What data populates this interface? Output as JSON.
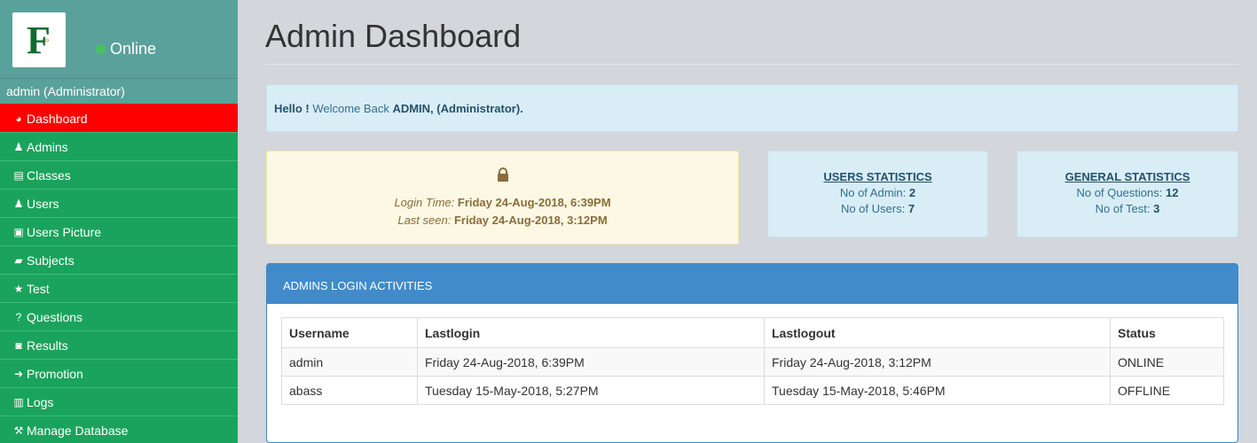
{
  "sidebar": {
    "status": "Online",
    "user": "admin (Administrator)",
    "items": [
      {
        "label": "Dashboard",
        "icon": "dashboard-icon",
        "glyph": "◕"
      },
      {
        "label": "Admins",
        "icon": "user-icon",
        "glyph": "♟"
      },
      {
        "label": "Classes",
        "icon": "list-alt-icon",
        "glyph": "▤"
      },
      {
        "label": "Users",
        "icon": "users-icon",
        "glyph": "♟"
      },
      {
        "label": "Users Picture",
        "icon": "picture-icon",
        "glyph": "▣"
      },
      {
        "label": "Subjects",
        "icon": "book-icon",
        "glyph": "▰"
      },
      {
        "label": "Test",
        "icon": "star-icon",
        "glyph": "★"
      },
      {
        "label": "Questions",
        "icon": "question-icon",
        "glyph": "?"
      },
      {
        "label": "Results",
        "icon": "file-icon",
        "glyph": "◙"
      },
      {
        "label": "Promotion",
        "icon": "arrow-circle-icon",
        "glyph": "➜"
      },
      {
        "label": "Logs",
        "icon": "trash-icon",
        "glyph": "▥"
      },
      {
        "label": "Manage Database",
        "icon": "wrench-icon",
        "glyph": "⚒"
      }
    ]
  },
  "main": {
    "title": "Admin Dashboard",
    "welcome": {
      "hello": "Hello !",
      "text": "Welcome Back",
      "name": "ADMIN, (Administrator)."
    },
    "login": {
      "login_label": "Login Time:",
      "login_value": "Friday 24-Aug-2018, 6:39PM",
      "seen_label": "Last seen:",
      "seen_value": "Friday 24-Aug-2018, 3:12PM"
    },
    "users_stats": {
      "title": "USERS STATISTICS",
      "admin_label": "No of Admin:",
      "admin_value": "2",
      "users_label": "No of Users:",
      "users_value": "7"
    },
    "general_stats": {
      "title": "GENERAL STATISTICS",
      "questions_label": "No of Questions:",
      "questions_value": "12",
      "test_label": "No of Test:",
      "test_value": "3"
    },
    "activities": {
      "title": "ADMINS LOGIN ACTIVITIES",
      "columns": [
        "Username",
        "Lastlogin",
        "Lastlogout",
        "Status"
      ],
      "rows": [
        [
          "admin",
          "Friday 24-Aug-2018, 6:39PM",
          "Friday 24-Aug-2018, 3:12PM",
          "ONLINE"
        ],
        [
          "abass",
          "Tuesday 15-May-2018, 5:27PM",
          "Tuesday 15-May-2018, 5:46PM",
          "OFFLINE"
        ]
      ]
    }
  },
  "colors": {
    "sidebar_header": "#5aa19b",
    "menu_green": "#1aa35c",
    "menu_active": "#ff0000",
    "panel_blue": "#428bca",
    "info_bg": "#d9edf7",
    "warning_bg": "#fcf8e3"
  }
}
